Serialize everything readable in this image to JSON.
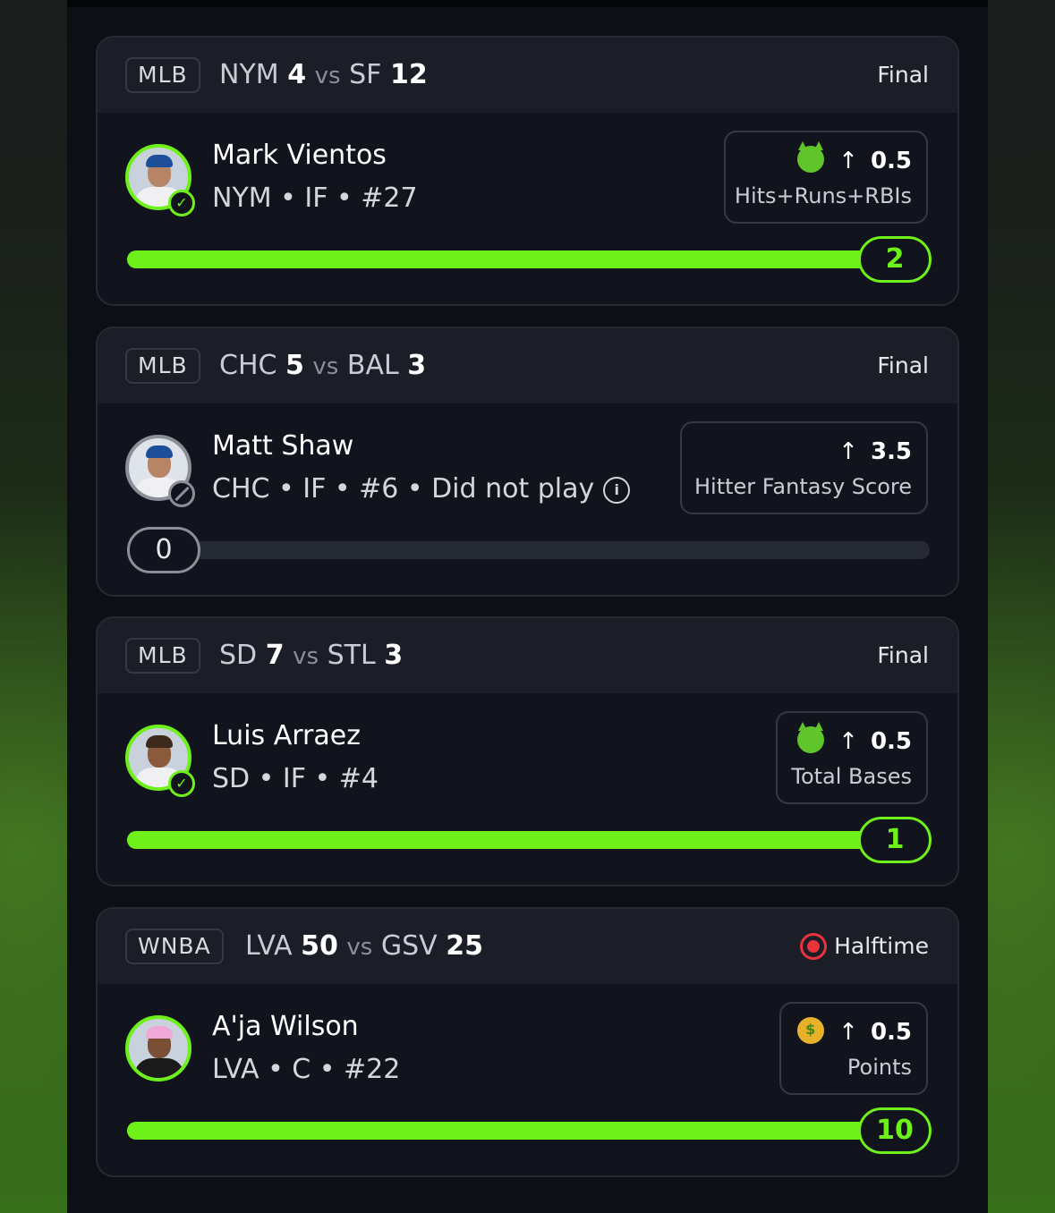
{
  "cards": [
    {
      "league": "MLB",
      "team1": "NYM",
      "score1": "4",
      "vs": "vs",
      "team2": "SF",
      "score2": "12",
      "status": "Final",
      "player": {
        "name": "Mark Vientos",
        "meta": "NYM • IF • #27"
      },
      "pick": {
        "direction": "↑",
        "line": "0.5",
        "stat": "Hits+Runs+RBIs",
        "emoji": "devil-emoji"
      },
      "result": "2",
      "progress": 1.0,
      "state": "hit"
    },
    {
      "league": "MLB",
      "team1": "CHC",
      "score1": "5",
      "vs": "vs",
      "team2": "BAL",
      "score2": "3",
      "status": "Final",
      "player": {
        "name": "Matt Shaw",
        "meta": "CHC • IF • #6 • Did not play"
      },
      "pick": {
        "direction": "↑",
        "line": "3.5",
        "stat": "Hitter Fantasy Score"
      },
      "result": "0",
      "progress": 0.0,
      "state": "dnp"
    },
    {
      "league": "MLB",
      "team1": "SD",
      "score1": "7",
      "vs": "vs",
      "team2": "STL",
      "score2": "3",
      "status": "Final",
      "player": {
        "name": "Luis Arraez",
        "meta": "SD • IF • #4"
      },
      "pick": {
        "direction": "↑",
        "line": "0.5",
        "stat": "Total Bases",
        "emoji": "devil-emoji"
      },
      "result": "1",
      "progress": 1.0,
      "state": "hit"
    },
    {
      "league": "WNBA",
      "team1": "LVA",
      "score1": "50",
      "vs": "vs",
      "team2": "GSV",
      "score2": "25",
      "status": "Halftime",
      "player": {
        "name": "A'ja Wilson",
        "meta": "LVA • C • #22"
      },
      "pick": {
        "direction": "↑",
        "line": "0.5",
        "stat": "Points",
        "emoji": "money-face-emoji"
      },
      "result": "10",
      "progress": 1.0,
      "state": "live"
    }
  ],
  "colors": {
    "accent": "#6ef01a",
    "live": "#e8323c",
    "background": "#0d0f14"
  }
}
